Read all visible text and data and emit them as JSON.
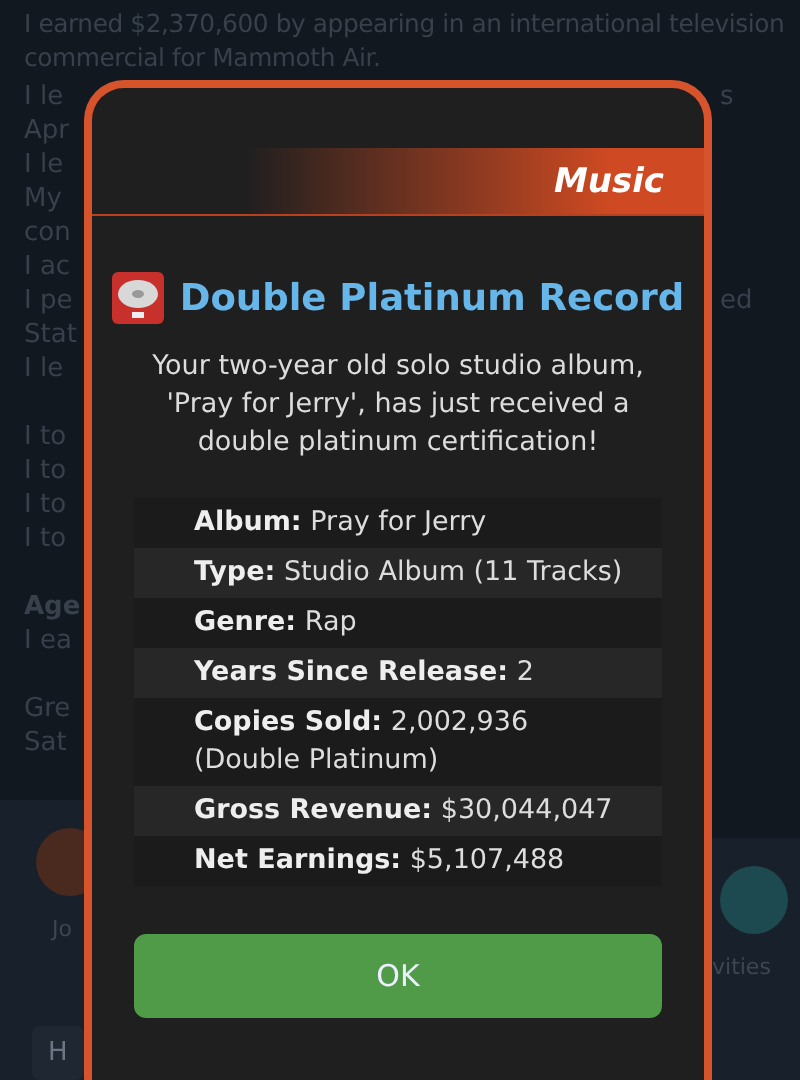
{
  "background": {
    "top_lines": [
      "I earned $2,370,600 by appearing in an international television",
      "commercial for Mammoth Air."
    ],
    "left_groups": [
      [
        {
          "text": "I le",
          "bold": false
        },
        {
          "text": "Apr",
          "bold": false
        },
        {
          "text": "I le",
          "bold": false
        },
        {
          "text": "My",
          "bold": false
        },
        {
          "text": "con",
          "bold": false
        },
        {
          "text": "I ac",
          "bold": false
        },
        {
          "text": "I pe",
          "bold": false
        },
        {
          "text": "Stat",
          "bold": false
        },
        {
          "text": "I le",
          "bold": false
        }
      ],
      [
        {
          "text": "I to",
          "bold": false
        },
        {
          "text": "I to",
          "bold": false
        },
        {
          "text": "I to",
          "bold": false
        },
        {
          "text": "I to",
          "bold": false
        }
      ],
      [
        {
          "text": "Age",
          "bold": true
        },
        {
          "text": "I ea",
          "bold": false
        }
      ],
      [
        {
          "text": "Gre",
          "bold": false
        },
        {
          "text": "Sat",
          "bold": false
        }
      ]
    ],
    "right_fragments": [
      "s",
      "ed"
    ],
    "bottom_bar": {
      "left_label": "Jo",
      "right_label": "vities"
    },
    "bottom_button_label": "H"
  },
  "dialog": {
    "category": "Music",
    "title": "Double Platinum Record",
    "message": "Your two-year old solo studio album, 'Pray for Jerry', has just received a double platinum certification!",
    "details": [
      {
        "label": "Album:",
        "value": "Pray for Jerry"
      },
      {
        "label": "Type:",
        "value": "Studio Album (11 Tracks)"
      },
      {
        "label": "Genre:",
        "value": "Rap"
      },
      {
        "label": "Years Since Release:",
        "value": "2"
      },
      {
        "label": "Copies Sold:",
        "value": "2,002,936 (Double Platinum)"
      },
      {
        "label": "Gross Revenue:",
        "value": "$30,044,047"
      },
      {
        "label": "Net Earnings:",
        "value": "$5,107,488"
      }
    ],
    "button": "OK"
  }
}
